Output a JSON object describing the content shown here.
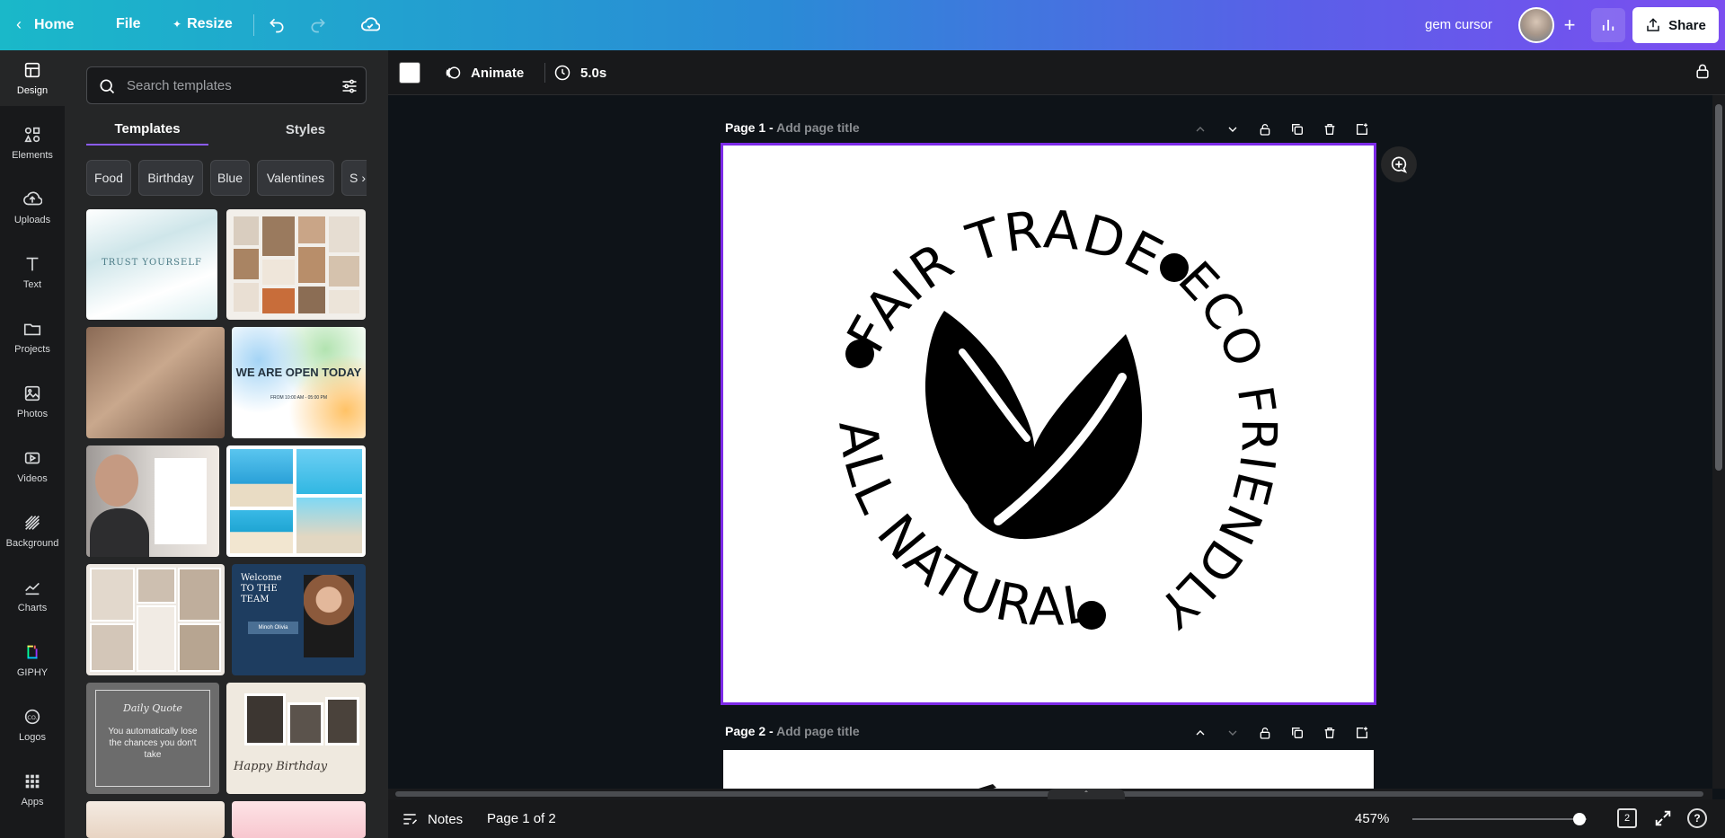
{
  "topbar": {
    "home_label": "Home",
    "file_label": "File",
    "resize_label": "Resize",
    "user_name": "gem cursor",
    "share_label": "Share"
  },
  "rail": {
    "items": [
      {
        "label": "Design",
        "icon": "layout-icon"
      },
      {
        "label": "Elements",
        "icon": "shapes-icon"
      },
      {
        "label": "Uploads",
        "icon": "cloud-upload-icon"
      },
      {
        "label": "Text",
        "icon": "text-icon"
      },
      {
        "label": "Projects",
        "icon": "folder-icon"
      },
      {
        "label": "Photos",
        "icon": "image-icon"
      },
      {
        "label": "Videos",
        "icon": "video-icon"
      },
      {
        "label": "Background",
        "icon": "pattern-icon"
      },
      {
        "label": "Charts",
        "icon": "chart-icon"
      },
      {
        "label": "GIPHY",
        "icon": "giphy-icon"
      },
      {
        "label": "Logos",
        "icon": "logo-icon"
      },
      {
        "label": "Apps",
        "icon": "apps-grid-icon"
      }
    ]
  },
  "panel": {
    "search_placeholder": "Search templates",
    "tabs": [
      "Templates",
      "Styles"
    ],
    "chips": [
      "Food",
      "Birthday",
      "Blue",
      "Valentines",
      "S"
    ],
    "thumbs": {
      "t1_text": "TRUST YOURSELF",
      "t4_heading": "WE ARE OPEN TODAY",
      "t4_sub": "FROM 10:00 AM - 05:00 PM",
      "t8_heading": "Welcome TO THE TEAM",
      "t8_tag": "Minoh Olivia",
      "t9_title": "Daily Quote",
      "t9_text": "You automatically lose the chances you don't take",
      "t10_text": "Happy Birthday"
    }
  },
  "context": {
    "animate_label": "Animate",
    "duration_label": "5.0s",
    "swatch_color": "#ffffff"
  },
  "canvas": {
    "page1_label": "Page 1 -",
    "page1_title_placeholder": "Add page title",
    "page2_label": "Page 2 -",
    "page2_title_placeholder": "Add page title",
    "badge": {
      "top_text": "FAIR TRADE",
      "right_text": "ECO FRIENDLY",
      "bottom_text": "ALL NATURAL",
      "left_text": "ALL NATURAL"
    }
  },
  "bottombar": {
    "notes_label": "Notes",
    "page_count": "Page 1 of 2",
    "zoom_level": "457%",
    "zoom_fraction": 0.96,
    "pages_count": "2",
    "help_label": "?"
  },
  "colors": {
    "accent": "#7d2ae8",
    "topbar_start": "#1ab8c9",
    "topbar_end": "#7b4ef0"
  }
}
